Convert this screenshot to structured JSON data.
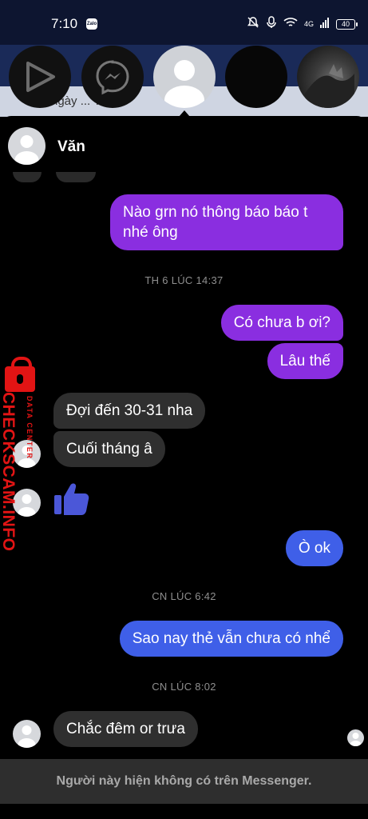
{
  "status_bar": {
    "time": "7:10",
    "notification_app": "Zalo",
    "network_label": "4G",
    "battery_level": "40",
    "icons": [
      "bell-off-icon",
      "mic-icon",
      "wifi-icon",
      "signal-icon",
      "battery-icon"
    ]
  },
  "background_app": {
    "partial_text": "ngày ... Tik"
  },
  "chat_heads": [
    {
      "name": "play-chat-head",
      "icon": "play-icon"
    },
    {
      "name": "messenger-chat-head",
      "icon": "messenger-icon"
    },
    {
      "name": "active-contact-chat-head",
      "icon": "default-avatar-icon"
    },
    {
      "name": "dark-chat-head",
      "icon": "none"
    },
    {
      "name": "photo-chat-head",
      "icon": "photo-avatar"
    }
  ],
  "conversation": {
    "contact_name": "Văn",
    "messages": [
      {
        "id": "m1",
        "direction": "outgoing",
        "text_lines": [
          "Nào grn nó thông báo báo t",
          "nhé ông"
        ]
      },
      {
        "id": "ts1",
        "type": "timestamp",
        "text": "TH 6 LÚC 14:37"
      },
      {
        "id": "m2",
        "direction": "outgoing",
        "text": "Có chưa b ơi?"
      },
      {
        "id": "m3",
        "direction": "outgoing",
        "text": "Lâu thế"
      },
      {
        "id": "m4",
        "direction": "incoming",
        "text": "Đợi đến 30-31 nha"
      },
      {
        "id": "m5",
        "direction": "incoming",
        "text": "Cuối tháng â"
      },
      {
        "id": "m6",
        "direction": "incoming",
        "type": "like",
        "icon": "thumbs-up-icon"
      },
      {
        "id": "m7",
        "direction": "outgoing",
        "text": "Ò ok"
      },
      {
        "id": "ts2",
        "type": "timestamp",
        "text": "CN LÚC 6:42"
      },
      {
        "id": "m8",
        "direction": "outgoing",
        "text": "Sao nay thẻ vẫn chưa có nhể"
      },
      {
        "id": "ts3",
        "type": "timestamp",
        "text": "CN LÚC 8:02"
      },
      {
        "id": "m9",
        "direction": "incoming",
        "text": "Chắc đêm or trưa"
      }
    ],
    "unavailable_notice": "Người này hiện không có trên Messenger."
  },
  "watermark": {
    "brand": "CHECKSCAM.INFO",
    "tagline": "DATA CENTER"
  },
  "colors": {
    "outgoing_purple": "#8a2ee0",
    "outgoing_blue": "#3f5fe8",
    "incoming_gray": "#2f2f2f",
    "like_blue": "#4b57d8",
    "watermark_red": "#e21414"
  }
}
